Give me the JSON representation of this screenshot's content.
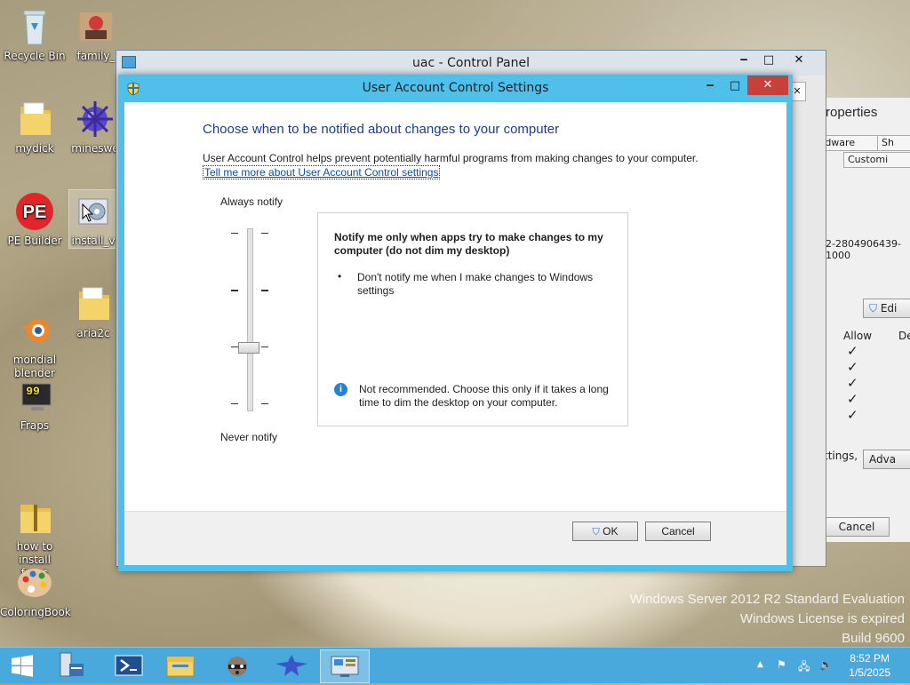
{
  "desktop": {
    "icons": [
      {
        "label": "Recycle Bin",
        "icon": "recycle-bin-icon"
      },
      {
        "label": "family_",
        "icon": "image-file-icon"
      },
      {
        "label": "mydick",
        "icon": "folder-icon"
      },
      {
        "label": "mineswe",
        "icon": "mine-icon"
      },
      {
        "label": "PE Builder",
        "icon": "pe-builder-icon"
      },
      {
        "label": "install_v",
        "icon": "setup-icon"
      },
      {
        "label": "mondial\nblender",
        "icon": "blender-icon"
      },
      {
        "label": "aria2c",
        "icon": "folder-icon"
      },
      {
        "label": "Fraps",
        "icon": "fraps-icon"
      },
      {
        "label": "how to install\nfraps",
        "icon": "zip-folder-icon"
      },
      {
        "label": "ColoringBook",
        "icon": "palette-icon"
      }
    ]
  },
  "control_panel": {
    "title": "uac - Control Panel"
  },
  "properties_window": {
    "title": "roperties",
    "tabs": [
      "rdware",
      "Sh",
      "Customi"
    ],
    "sid": "2-2804906439-1000",
    "edit": "Edi",
    "allow": "Allow",
    "deny": "De",
    "checks": [
      "✓",
      "✓",
      "✓",
      "✓",
      "✓"
    ],
    "settings": "ttings,",
    "advanced": "Adva",
    "cancel": "Cancel"
  },
  "uac_dialog": {
    "title": "User Account Control Settings",
    "heading": "Choose when to be notified about changes to your computer",
    "description": "User Account Control helps prevent potentially harmful programs from making changes to your computer.",
    "link": "Tell me more about User Account Control settings",
    "always_notify": "Always notify",
    "never_notify": "Never notify",
    "slider_level": 2,
    "slider_levels_total": 4,
    "info_heading": "Notify me only when apps try to make changes to my computer (do not dim my desktop)",
    "bullet": "Don't notify me when I make changes to Windows settings",
    "note": "Not recommended. Choose this only if it takes a long time to dim the desktop on your computer.",
    "ok": "OK",
    "cancel": "Cancel"
  },
  "watermark": {
    "line1": "Windows Server 2012 R2 Standard Evaluation",
    "line2": "Windows License is expired",
    "line3": "Build 9600"
  },
  "taskbar": {
    "time": "8:52 PM",
    "date": "1/5/2025",
    "items": [
      "start",
      "server-manager",
      "powershell",
      "file-explorer",
      "raccoon-app",
      "dragon-app",
      "control-panel"
    ]
  }
}
